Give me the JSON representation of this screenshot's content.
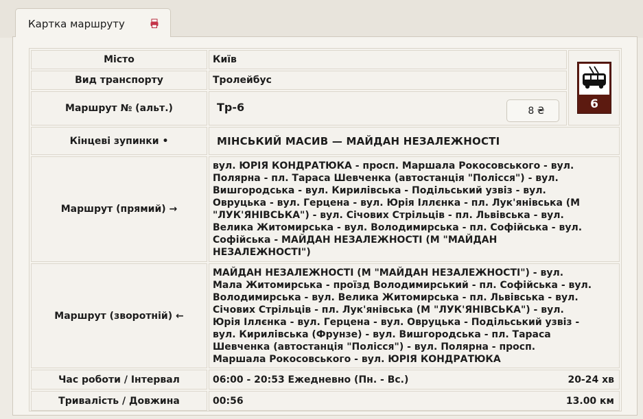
{
  "tab": {
    "label": "Картка маршруту"
  },
  "rows": {
    "city": {
      "label": "Місто",
      "value": "Київ"
    },
    "transport": {
      "label": "Вид транспорту",
      "value": "Тролейбус"
    },
    "route_no": {
      "label": "Маршрут № (альт.)",
      "value": "Тр-6",
      "price": "8 ₴"
    },
    "terminals": {
      "label": "Кінцеві зупинки •",
      "value": "МІНСЬКИЙ МАСИВ — МАЙДАН НЕЗАЛЕЖНОСТІ"
    },
    "forward": {
      "label": "Маршрут (прямий) →",
      "lines": [
        "вул. ЮРІЯ КОНДРАТЮКА - просп. Маршала Рокосовського - вул.",
        "Полярна - пл. Тараса Шевченка (автостанція \"Полісся\") - вул.",
        "Вишгородська - вул. Кирилівська - Подільський узвіз - вул.",
        "Овруцька - вул. Герцена - вул. Юрія Іллєнка - пл. Лук'янівська (М",
        "\"ЛУК'ЯНІВСЬКА\") - вул. Січових Стрільців - пл. Львівська - вул.",
        "Велика Житомирська - вул. Володимирська - пл. Софійська - вул.",
        "Софійська - МАЙДАН НЕЗАЛЕЖНОСТІ (М \"МАЙДАН",
        "НЕЗАЛЕЖНОСТІ\")"
      ]
    },
    "backward": {
      "label": "Маршрут (зворотній) ←",
      "lines": [
        "МАЙДАН НЕЗАЛЕЖНОСТІ (М \"МАЙДАН НЕЗАЛЕЖНОСТІ\") - вул.",
        "Мала Житомирська - проїзд Володимирський - пл. Софійська - вул.",
        "Володимирська - вул. Велика Житомирська - пл. Львівська - вул.",
        "Січових Стрільців - пл. Лук'янівська (М \"ЛУК'ЯНІВСЬКА\") - вул.",
        "Юрія Іллєнка - вул. Герцена - вул. Овруцька - Подільський узвіз -",
        "вул. Кирилівська (Фрунзе) - вул. Вишгородська - пл. Тараса",
        "Шевченка (автостанція \"Полісся\") - вул. Полярна - просп.",
        "Маршала Рокосовського - вул. ЮРІЯ КОНДРАТЮКА"
      ]
    },
    "hours": {
      "label": "Час роботи / Інтервал",
      "value": "06:00 - 20:53 Ежедневно (Пн. - Вс.)",
      "interval": "20-24 хв"
    },
    "duration": {
      "label": "Тривалість / Довжина",
      "value": "00:56",
      "length": "13.00 км"
    }
  },
  "badge": {
    "number": "6",
    "icon": "trolleybus-icon",
    "color": "#5c1a10"
  },
  "icons": {
    "tab": "printer-icon"
  }
}
